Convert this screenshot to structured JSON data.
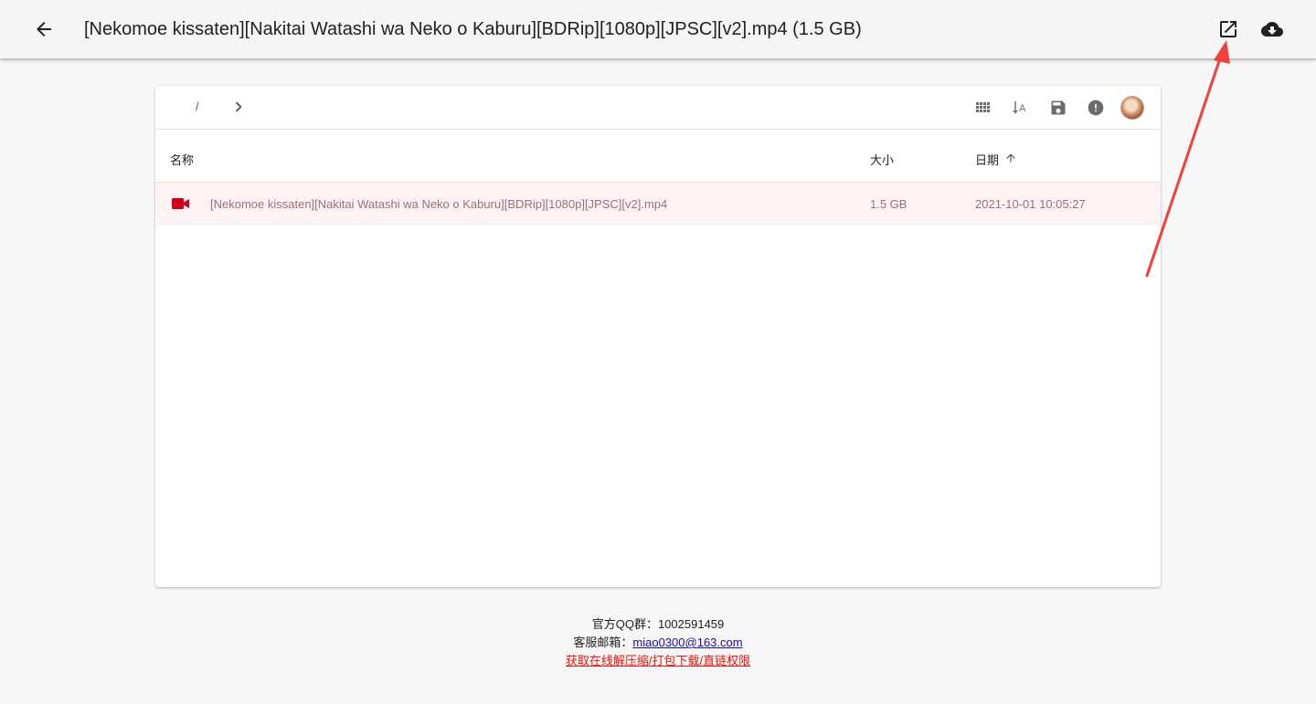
{
  "appbar": {
    "title": "[Nekomoe kissaten][Nakitai Watashi wa Neko o Kaburu][BDRip][1080p][JPSC][v2].mp4 (1.5 GB)",
    "back_icon": "arrow-left-icon",
    "open_icon": "open-in-new-icon",
    "download_icon": "cloud-download-icon"
  },
  "breadcrumb": {
    "separator": "/",
    "next_icon": "chevron-right-icon"
  },
  "toolbar": {
    "icons": [
      "grid-view-icon",
      "sort-alpha-icon",
      "save-icon",
      "info-alert-icon",
      "avatar"
    ]
  },
  "table": {
    "headers": {
      "name": "名称",
      "size": "大小",
      "date": "日期"
    },
    "sort_icon": "arrow-up-icon",
    "rows": [
      {
        "icon": "video-camera-icon",
        "name": "[Nekomoe kissaten][Nakitai Watashi wa Neko o Kaburu][BDRip][1080p][JPSC][v2].mp4",
        "size": "1.5 GB",
        "date": "2021-10-01 10:05:27"
      }
    ]
  },
  "footer": {
    "qq_label": "官方QQ群：",
    "qq_value": "1002591459",
    "email_label": "客服邮箱：",
    "email_value": "miao0300@163.com",
    "promo_link": "获取在线解压缩/打包下载/直链权限"
  },
  "colors": {
    "appbar_bg": "#f5f5f5",
    "page_bg": "#f7f7f7",
    "row_highlight": "#fff2f3",
    "video_icon": "#d0021b",
    "annotation_arrow": "#f0413a",
    "promo_link": "#e8160c"
  }
}
